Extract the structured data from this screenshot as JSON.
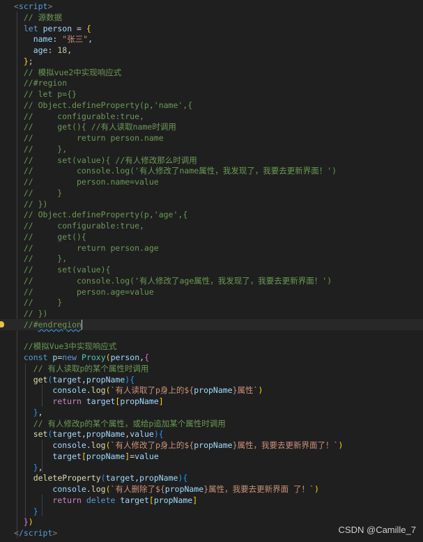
{
  "editor": {
    "background": "#1f1f1f",
    "lines": [
      [
        [
          "<",
          "bracket"
        ],
        [
          "script",
          "tag"
        ],
        [
          ">",
          "bracket"
        ]
      ],
      [
        [
          "  // 源数据",
          "comment"
        ]
      ],
      [
        [
          "  ",
          "plain"
        ],
        [
          "let",
          "kw"
        ],
        [
          " ",
          "plain"
        ],
        [
          "person",
          "var"
        ],
        [
          " = ",
          "punc"
        ],
        [
          "{",
          "brace1"
        ]
      ],
      [
        [
          "    ",
          "plain"
        ],
        [
          "name",
          "var"
        ],
        [
          ": ",
          "punc"
        ],
        [
          "\"张三\"",
          "str"
        ],
        [
          ",",
          "punc"
        ]
      ],
      [
        [
          "    ",
          "plain"
        ],
        [
          "age",
          "var"
        ],
        [
          ": ",
          "punc"
        ],
        [
          "18",
          "num"
        ],
        [
          ",",
          "punc"
        ]
      ],
      [
        [
          "  ",
          "plain"
        ],
        [
          "}",
          "brace1"
        ],
        [
          ";",
          "punc"
        ]
      ],
      [
        [
          "  // 模拟vue2中实现响应式",
          "comment"
        ]
      ],
      [
        [
          "  //#region",
          "comment"
        ]
      ],
      [
        [
          "  // let p={}",
          "comment"
        ]
      ],
      [
        [
          "  // Object.defineProperty(p,'name',{",
          "comment"
        ]
      ],
      [
        [
          "  //     configurable:true,",
          "comment"
        ]
      ],
      [
        [
          "  //     get(){ //有人读取name时调用",
          "comment"
        ]
      ],
      [
        [
          "  //         return person.name",
          "comment"
        ]
      ],
      [
        [
          "  //     },",
          "comment"
        ]
      ],
      [
        [
          "  //     set(value){ //有人修改那么时调用",
          "comment"
        ]
      ],
      [
        [
          "  //         console.log('有人修改了name属性，我发现了，我要去更新界面！')",
          "comment"
        ]
      ],
      [
        [
          "  //         person.name=value",
          "comment"
        ]
      ],
      [
        [
          "  //     }",
          "comment"
        ]
      ],
      [
        [
          "  // })",
          "comment"
        ]
      ],
      [
        [
          "  // Object.defineProperty(p,'age',{",
          "comment"
        ]
      ],
      [
        [
          "  //     configurable:true,",
          "comment"
        ]
      ],
      [
        [
          "  //     get(){",
          "comment"
        ]
      ],
      [
        [
          "  //         return person.age",
          "comment"
        ]
      ],
      [
        [
          "  //     },",
          "comment"
        ]
      ],
      [
        [
          "  //     set(value){",
          "comment"
        ]
      ],
      [
        [
          "  //         console.log('有人修改了age属性，我发现了，我要去更新界面！')",
          "comment"
        ]
      ],
      [
        [
          "  //         person.age=value",
          "comment"
        ]
      ],
      [
        [
          "  //     }",
          "comment"
        ]
      ],
      [
        [
          "  // })",
          "comment"
        ]
      ],
      [
        [
          "  //#",
          "comment"
        ],
        [
          "endregion",
          "comment squiggle"
        ]
      ],
      [],
      [
        [
          "  //模拟Vue3中实现响应式",
          "comment"
        ]
      ],
      [
        [
          "  ",
          "plain"
        ],
        [
          "const",
          "kw"
        ],
        [
          " ",
          "plain"
        ],
        [
          "p",
          "var"
        ],
        [
          "=",
          "punc"
        ],
        [
          "new",
          "kw"
        ],
        [
          " ",
          "plain"
        ],
        [
          "Proxy",
          "cls"
        ],
        [
          "(",
          "brace1"
        ],
        [
          "person",
          "var"
        ],
        [
          ",",
          "punc"
        ],
        [
          "{",
          "brace2"
        ]
      ],
      [
        [
          "    // 有人读取p的某个属性时调用",
          "comment"
        ]
      ],
      [
        [
          "    ",
          "plain"
        ],
        [
          "get",
          "fn"
        ],
        [
          "(",
          "brace3"
        ],
        [
          "target",
          "var"
        ],
        [
          ",",
          "punc"
        ],
        [
          "propName",
          "var"
        ],
        [
          ")",
          "brace3"
        ],
        [
          "{",
          "brace3"
        ]
      ],
      [
        [
          "        ",
          "plain"
        ],
        [
          "console",
          "var"
        ],
        [
          ".",
          "punc"
        ],
        [
          "log",
          "fn"
        ],
        [
          "(",
          "brace1"
        ],
        [
          "`有人读取了p身上的${",
          "str"
        ],
        [
          "propName",
          "var"
        ],
        [
          "}属性`",
          "str"
        ],
        [
          ")",
          "brace1"
        ]
      ],
      [
        [
          "        ",
          "plain"
        ],
        [
          "return",
          "ctrl"
        ],
        [
          " ",
          "plain"
        ],
        [
          "target",
          "var"
        ],
        [
          "[",
          "brace1"
        ],
        [
          "propName",
          "var"
        ],
        [
          "]",
          "brace1"
        ]
      ],
      [
        [
          "    ",
          "plain"
        ],
        [
          "}",
          "brace3"
        ],
        [
          ",",
          "punc"
        ]
      ],
      [
        [
          "    // 有人修改p的某个属性，或给p追加某个属性时调用",
          "comment"
        ]
      ],
      [
        [
          "    ",
          "plain"
        ],
        [
          "set",
          "fn"
        ],
        [
          "(",
          "brace3"
        ],
        [
          "target",
          "var"
        ],
        [
          ",",
          "punc"
        ],
        [
          "propName",
          "var"
        ],
        [
          ",",
          "punc"
        ],
        [
          "value",
          "var"
        ],
        [
          ")",
          "brace3"
        ],
        [
          "{",
          "brace3"
        ]
      ],
      [
        [
          "        ",
          "plain"
        ],
        [
          "console",
          "var"
        ],
        [
          ".",
          "punc"
        ],
        [
          "log",
          "fn"
        ],
        [
          "(",
          "brace1"
        ],
        [
          "`有人修改了p身上的${",
          "str"
        ],
        [
          "propName",
          "var"
        ],
        [
          "}属性，我要去更新界面了！`",
          "str"
        ],
        [
          ")",
          "brace1"
        ]
      ],
      [
        [
          "        ",
          "plain"
        ],
        [
          "target",
          "var"
        ],
        [
          "[",
          "brace1"
        ],
        [
          "propName",
          "var"
        ],
        [
          "]",
          "brace1"
        ],
        [
          "=",
          "punc"
        ],
        [
          "value",
          "var"
        ]
      ],
      [
        [
          "    ",
          "plain"
        ],
        [
          "}",
          "brace3"
        ],
        [
          ",",
          "punc"
        ]
      ],
      [
        [
          "    ",
          "plain"
        ],
        [
          "deleteProperty",
          "fn"
        ],
        [
          "(",
          "brace3"
        ],
        [
          "target",
          "var"
        ],
        [
          ",",
          "punc"
        ],
        [
          "propName",
          "var"
        ],
        [
          ")",
          "brace3"
        ],
        [
          "{",
          "brace3"
        ]
      ],
      [
        [
          "        ",
          "plain"
        ],
        [
          "console",
          "var"
        ],
        [
          ".",
          "punc"
        ],
        [
          "log",
          "fn"
        ],
        [
          "(",
          "brace1"
        ],
        [
          "`有人删除了${",
          "str"
        ],
        [
          "propName",
          "var"
        ],
        [
          "}属性，我要去更新界面 了！`",
          "str"
        ],
        [
          ")",
          "brace1"
        ]
      ],
      [
        [
          "        ",
          "plain"
        ],
        [
          "return",
          "ctrl"
        ],
        [
          " ",
          "plain"
        ],
        [
          "delete",
          "kw"
        ],
        [
          " ",
          "plain"
        ],
        [
          "target",
          "var"
        ],
        [
          "[",
          "brace1"
        ],
        [
          "propName",
          "var"
        ],
        [
          "]",
          "brace1"
        ]
      ],
      [
        [
          "    ",
          "plain"
        ],
        [
          "}",
          "brace3"
        ]
      ],
      [
        [
          "  ",
          "plain"
        ],
        [
          "}",
          "brace2"
        ],
        [
          ")",
          "brace1"
        ]
      ],
      [
        [
          "<",
          "bracket"
        ],
        [
          "/script",
          "tag"
        ],
        [
          ">",
          "bracket"
        ]
      ]
    ],
    "active_line": 29,
    "lightbulb_line": 29
  },
  "watermark": "CSDN @Camille_7"
}
